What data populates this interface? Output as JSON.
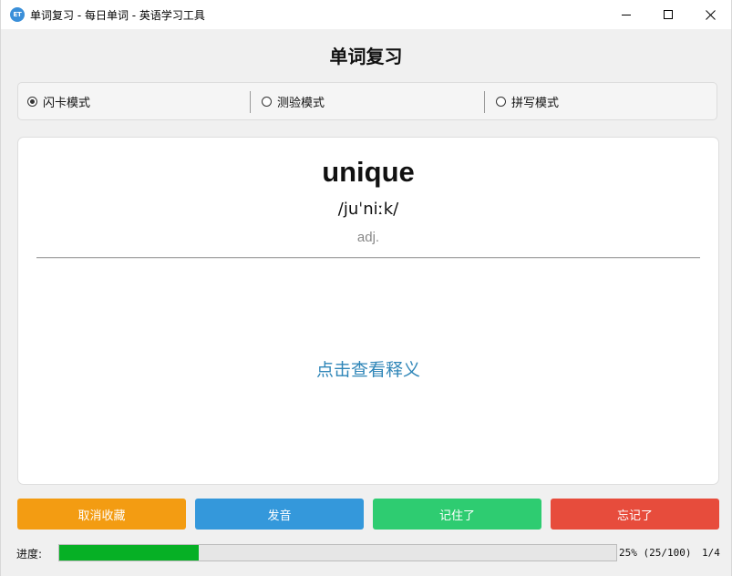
{
  "window": {
    "title": "单词复习 - 每日单词 - 英语学习工具",
    "icon_text": "ET",
    "icon_color": "#3a8fd9"
  },
  "page": {
    "title": "单词复习"
  },
  "modes": [
    {
      "label": "闪卡模式",
      "selected": true
    },
    {
      "label": "测验模式",
      "selected": false
    },
    {
      "label": "拼写模式",
      "selected": false
    }
  ],
  "card": {
    "word": "unique",
    "phonetic": "/juˈniːk/",
    "part_of_speech": "adj.",
    "reveal_hint": "点击查看释义"
  },
  "actions": [
    {
      "label": "取消收藏",
      "color": "#f39c12"
    },
    {
      "label": "发音",
      "color": "#3498db"
    },
    {
      "label": "记住了",
      "color": "#2ecc71"
    },
    {
      "label": "忘记了",
      "color": "#e74c3c"
    }
  ],
  "progress": {
    "label": "进度:",
    "fraction": 0.25,
    "text": "25% (25/100)",
    "counter": "1/4",
    "fill_color": "#06b025"
  }
}
